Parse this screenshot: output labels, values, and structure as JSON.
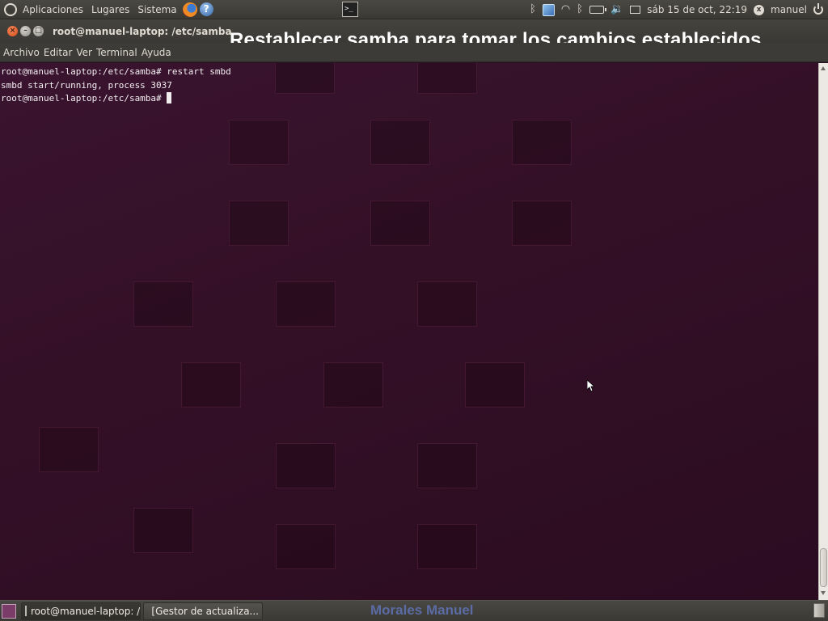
{
  "top_panel": {
    "menus": [
      "Aplicaciones",
      "Lugares",
      "Sistema"
    ],
    "clock": "sáb 15 de oct, 22:19",
    "user": "manuel"
  },
  "window": {
    "title": "root@manuel-laptop: /etc/samba",
    "overlay_caption": "Restablecer samba para tomar los cambios establecidos",
    "menubar": [
      "Archivo",
      "Editar",
      "Ver",
      "Terminal",
      "Ayuda"
    ]
  },
  "terminal": {
    "lines": [
      "root@manuel-laptop:/etc/samba# restart smbd",
      "smbd start/running, process 3037",
      "root@manuel-laptop:/etc/samba# "
    ]
  },
  "taskbar": {
    "tasks": [
      {
        "label": "root@manuel-laptop: /e...",
        "active": true
      },
      {
        "label": "[Gestor de actualiza...",
        "active": false
      }
    ],
    "watermark": "Morales Manuel"
  },
  "colors": {
    "terminal_bg": "#2c0f22",
    "panel_bg": "#3c3b37",
    "close_button": "#d44a1c"
  },
  "icons": [
    "ubuntu-logo-icon",
    "firefox-icon",
    "help-icon",
    "terminal-launcher-icon",
    "bluetooth-icon",
    "network-icon",
    "wifi-icon",
    "battery-icon",
    "volume-icon",
    "mail-icon",
    "user-icon",
    "power-icon",
    "trash-icon"
  ]
}
